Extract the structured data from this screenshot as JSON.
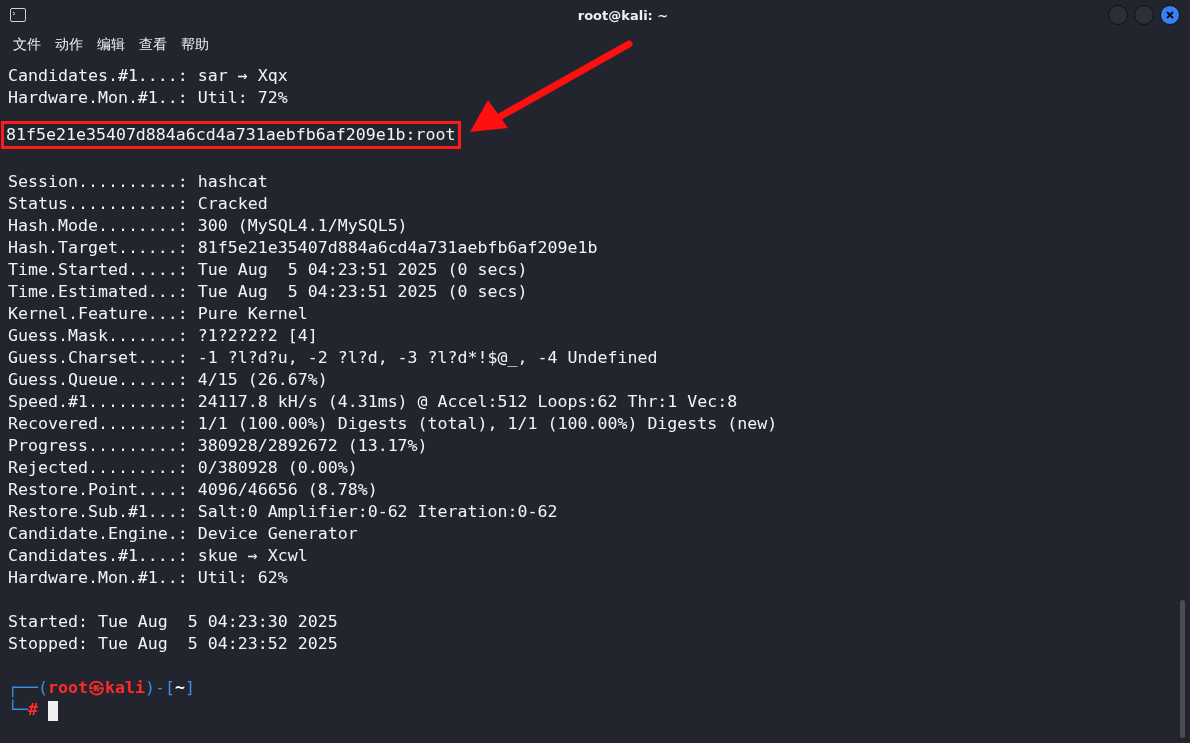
{
  "window": {
    "title": "root@kali: ~"
  },
  "menu": [
    "文件",
    "动作",
    "编辑",
    "查看",
    "帮助"
  ],
  "lines": [
    {
      "kind": "output",
      "text": "Candidates.#1....: sar → Xqx"
    },
    {
      "kind": "output",
      "text": "Hardware.Mon.#1..: Util: 72%"
    },
    {
      "kind": "blank"
    },
    {
      "kind": "highlight",
      "text": "81f5e21e35407d884a6cd4a731aebfb6af209e1b:root",
      "arrow": true
    },
    {
      "kind": "blank"
    },
    {
      "kind": "output",
      "text": "Session..........: hashcat"
    },
    {
      "kind": "output",
      "text": "Status...........: Cracked"
    },
    {
      "kind": "output",
      "text": "Hash.Mode........: 300 (MySQL4.1/MySQL5)"
    },
    {
      "kind": "output",
      "text": "Hash.Target......: 81f5e21e35407d884a6cd4a731aebfb6af209e1b"
    },
    {
      "kind": "output",
      "text": "Time.Started.....: Tue Aug  5 04:23:51 2025 (0 secs)"
    },
    {
      "kind": "output",
      "text": "Time.Estimated...: Tue Aug  5 04:23:51 2025 (0 secs)"
    },
    {
      "kind": "output",
      "text": "Kernel.Feature...: Pure Kernel"
    },
    {
      "kind": "output",
      "text": "Guess.Mask.......: ?1?2?2?2 [4]"
    },
    {
      "kind": "output",
      "text": "Guess.Charset....: -1 ?l?d?u, -2 ?l?d, -3 ?l?d*!$@_, -4 Undefined"
    },
    {
      "kind": "output",
      "text": "Guess.Queue......: 4/15 (26.67%)"
    },
    {
      "kind": "output",
      "text": "Speed.#1.........: 24117.8 kH/s (4.31ms) @ Accel:512 Loops:62 Thr:1 Vec:8"
    },
    {
      "kind": "output",
      "text": "Recovered........: 1/1 (100.00%) Digests (total), 1/1 (100.00%) Digests (new)"
    },
    {
      "kind": "output",
      "text": "Progress.........: 380928/2892672 (13.17%)"
    },
    {
      "kind": "output",
      "text": "Rejected.........: 0/380928 (0.00%)"
    },
    {
      "kind": "output",
      "text": "Restore.Point....: 4096/46656 (8.78%)"
    },
    {
      "kind": "output",
      "text": "Restore.Sub.#1...: Salt:0 Amplifier:0-62 Iteration:0-62"
    },
    {
      "kind": "output",
      "text": "Candidate.Engine.: Device Generator"
    },
    {
      "kind": "output",
      "text": "Candidates.#1....: skue → Xcwl"
    },
    {
      "kind": "output",
      "text": "Hardware.Mon.#1..: Util: 62%"
    },
    {
      "kind": "blank"
    },
    {
      "kind": "output",
      "text": "Started: Tue Aug  5 04:23:30 2025"
    },
    {
      "kind": "output",
      "text": "Stopped: Tue Aug  5 04:23:52 2025"
    },
    {
      "kind": "blank"
    }
  ],
  "prompt": {
    "open": "┌──(",
    "user_host": "root㉿kali",
    "mid": ")-[",
    "dir": "~",
    "close": "]",
    "corner": "└─",
    "symbol": "#"
  }
}
